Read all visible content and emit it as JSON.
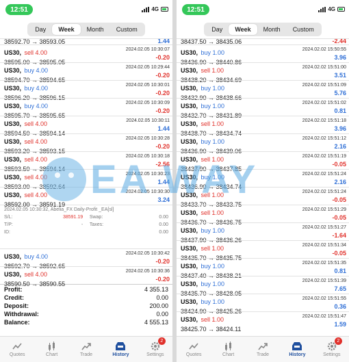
{
  "status_bar": {
    "time": "12:51",
    "network": "4G"
  },
  "periods": [
    "Day",
    "Week",
    "Month",
    "Custom"
  ],
  "active_period": "Week",
  "watermark_text": "EA  WAY",
  "left_screen": {
    "partial_top": {
      "prices": "38592.70 → 38593.05",
      "pl": "1.44"
    },
    "deals": [
      {
        "symbol": "US30,",
        "action": "sell 4.00",
        "side": "sell",
        "datetime": "2024.02.05 10:30:07",
        "prices": "38595.00 → 38595.05",
        "pl": "-0.20"
      },
      {
        "symbol": "US30,",
        "action": "buy 4.00",
        "side": "buy",
        "datetime": "2024.02.05 10:29:44",
        "prices": "38594.70 → 38594.65",
        "pl": "-0.20"
      },
      {
        "symbol": "US30,",
        "action": "buy 4.00",
        "side": "buy",
        "datetime": "2024.02.05 10:30:01",
        "prices": "38596.20 → 38596.15",
        "pl": "-0.20"
      },
      {
        "symbol": "US30,",
        "action": "buy 4.00",
        "side": "buy",
        "datetime": "2024.02.05 10:30:09",
        "prices": "38595.70 → 38595.65",
        "pl": "-0.20"
      },
      {
        "symbol": "US30,",
        "action": "sell 4.00",
        "side": "sell",
        "datetime": "2024.02.05 10:30:11",
        "prices": "38594.50 → 38594.14",
        "pl": "1.44"
      },
      {
        "symbol": "US30,",
        "action": "sell 4.00",
        "side": "sell",
        "datetime": "2024.02.05 10:30:28",
        "prices": "38593.20 → 38593.15",
        "pl": "-0.20"
      },
      {
        "symbol": "US30,",
        "action": "sell 4.00",
        "side": "sell",
        "datetime": "2024.02.05 10:30:18",
        "prices": "38593.50 → 38594.14",
        "pl": "-2.56"
      },
      {
        "symbol": "US30,",
        "action": "sell 4.00",
        "side": "sell",
        "datetime": "2024.02.05 10:30:23",
        "prices": "38593.00 → 38592.64",
        "pl": "1.44"
      },
      {
        "symbol": "US30,",
        "action": "sell 4.00",
        "side": "sell",
        "datetime": "2024.02.05 10:30:30",
        "prices": "38592.00 → 38591.19",
        "pl": "3.24"
      }
    ],
    "detail": {
      "comment": "2024.02.05 10:30:32, Abelia_FX Daily-Profit _EA[sl]",
      "sl_label": "S/L:",
      "sl_value": "38591.19",
      "swap_label": "Swap:",
      "swap_value": "0.00",
      "tp_label": "T/P:",
      "tp_value": "-",
      "taxes_label": "Taxes:",
      "taxes_value": "0.00",
      "id_label": "ID:",
      "id_value": "0.00"
    },
    "deals_after": [
      {
        "symbol": "US30,",
        "action": "buy 4.00",
        "side": "buy",
        "datetime": "2024.02.05 10:30:42",
        "prices": "38592.70 → 38592.65",
        "pl": "-0.20"
      },
      {
        "symbol": "US30,",
        "action": "sell 4.00",
        "side": "sell",
        "datetime": "2024.02.05 10:30:36",
        "prices": "38590.50 → 38590.55",
        "pl": "-0.20"
      }
    ],
    "summary": [
      {
        "label": "Profit:",
        "value": "4 355.13"
      },
      {
        "label": "Credit:",
        "value": "0.00"
      },
      {
        "label": "Deposit:",
        "value": "200.00"
      },
      {
        "label": "Withdrawal:",
        "value": "0.00"
      },
      {
        "label": "Balance:",
        "value": "4 555.13"
      }
    ]
  },
  "right_screen": {
    "partial_top": {
      "prices": "38437.50 → 38435.06",
      "pl": "-2.44"
    },
    "deals": [
      {
        "symbol": "US30,",
        "action": "buy 1.00",
        "side": "buy",
        "datetime": "2024.02.02 15:50:55",
        "prices": "38436.90 → 38440.86",
        "pl": "3.96"
      },
      {
        "symbol": "US30,",
        "action": "sell 1.00",
        "side": "sell",
        "datetime": "2024.02.02 15:51:00",
        "prices": "38438.20 → 38434.69",
        "pl": "3.51"
      },
      {
        "symbol": "US30,",
        "action": "buy 1.00",
        "side": "buy",
        "datetime": "2024.02.02 15:51:09",
        "prices": "38432.90 → 38438.66",
        "pl": "5.76"
      },
      {
        "symbol": "US30,",
        "action": "buy 1.00",
        "side": "buy",
        "datetime": "2024.02.02 15:51:02",
        "prices": "38432.70 → 38431.89",
        "pl": "0.81"
      },
      {
        "symbol": "US30,",
        "action": "sell 1.00",
        "side": "sell",
        "datetime": "2024.02.02 15:51:18",
        "prices": "38438.70 → 38434.74",
        "pl": "3.96"
      },
      {
        "symbol": "US30,",
        "action": "buy 1.00",
        "side": "buy",
        "datetime": "2024.02.02 15:51:12",
        "prices": "38436.90 → 38439.06",
        "pl": "2.16"
      },
      {
        "symbol": "US30,",
        "action": "sell 1.00",
        "side": "sell",
        "datetime": "2024.02.02 15:51:19",
        "prices": "38437.90 → 38437.85",
        "pl": "-0.05"
      },
      {
        "symbol": "US30,",
        "action": "buy 1.00",
        "side": "buy",
        "datetime": "2024.02.02 15:51:24",
        "prices": "38436.90 → 38434.74",
        "pl": "2.16"
      },
      {
        "symbol": "US30,",
        "action": "sell 1.00",
        "side": "sell",
        "datetime": "2024.02.02 15:51:24",
        "prices": "38433.70 → 38433.75",
        "pl": "-0.05"
      },
      {
        "symbol": "US30,",
        "action": "sell 1.00",
        "side": "sell",
        "datetime": "2024.02.02 15:51:29",
        "prices": "38436.70 → 38436.75",
        "pl": "-0.05"
      },
      {
        "symbol": "US30,",
        "action": "buy 1.00",
        "side": "buy",
        "datetime": "2024.02.02 15:51:27",
        "prices": "38437.90 → 38436.26",
        "pl": "-1.64"
      },
      {
        "symbol": "US30,",
        "action": "sell 1.00",
        "side": "sell",
        "datetime": "2024.02.02 15:51:34",
        "prices": "38435.70 → 38435.75",
        "pl": "-0.05"
      },
      {
        "symbol": "US30,",
        "action": "buy 1.00",
        "side": "buy",
        "datetime": "2024.02.02 15:51:35",
        "prices": "38437.40 → 38438.21",
        "pl": "0.81"
      },
      {
        "symbol": "US30,",
        "action": "buy 1.00",
        "side": "buy",
        "datetime": "2024.02.02 15:51:39",
        "prices": "38435.70 → 38428.05",
        "pl": "7.65"
      },
      {
        "symbol": "US30,",
        "action": "buy 1.00",
        "side": "buy",
        "datetime": "2024.02.02 15:51:55",
        "prices": "38424.90 → 38425.26",
        "pl": "0.36"
      },
      {
        "symbol": "US30,",
        "action": "sell 1.00",
        "side": "sell",
        "datetime": "2024.02.02 15:51:47",
        "prices": "38425.70 → 38424.11",
        "pl": "1.59"
      }
    ]
  },
  "tabs": [
    {
      "label": "Quotes",
      "icon": "quotes-icon"
    },
    {
      "label": "Chart",
      "icon": "chart-icon"
    },
    {
      "label": "Trade",
      "icon": "trade-icon"
    },
    {
      "label": "History",
      "icon": "history-icon"
    },
    {
      "label": "Settings",
      "icon": "settings-icon"
    }
  ],
  "active_tab": "History",
  "settings_badge": "2",
  "colors": {
    "sell": "#e0312b",
    "buy": "#2f6fd6",
    "accent": "#1f4f9e",
    "status_pill": "#34c759"
  }
}
